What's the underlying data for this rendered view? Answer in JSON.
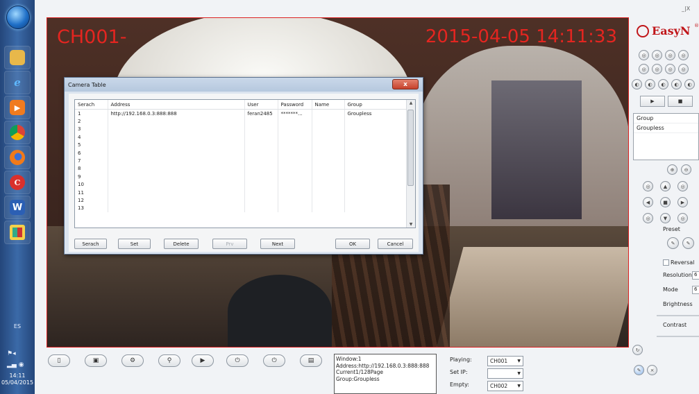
{
  "taskbar": {
    "language": "ES",
    "time": "14:11",
    "date": "05/04/2015"
  },
  "video": {
    "channel_label": "CH001-",
    "datetime": "2015-04-05 14:11:33"
  },
  "dialog": {
    "title": "Camera Table",
    "close_glyph": "x",
    "columns": [
      "Serach",
      "Address",
      "User",
      "Password",
      "Name",
      "Group"
    ],
    "rows": [
      [
        "1",
        "http://192.168.0.3:888:888",
        "feran2485",
        "*******...",
        "",
        "Groupless"
      ],
      [
        "2",
        "",
        "",
        "",
        "",
        ""
      ],
      [
        "3",
        "",
        "",
        "",
        "",
        ""
      ],
      [
        "4",
        "",
        "",
        "",
        "",
        ""
      ],
      [
        "5",
        "",
        "",
        "",
        "",
        ""
      ],
      [
        "6",
        "",
        "",
        "",
        "",
        ""
      ],
      [
        "7",
        "",
        "",
        "",
        "",
        ""
      ],
      [
        "8",
        "",
        "",
        "",
        "",
        ""
      ],
      [
        "9",
        "",
        "",
        "",
        "",
        ""
      ],
      [
        "10",
        "",
        "",
        "",
        "",
        ""
      ],
      [
        "11",
        "",
        "",
        "",
        "",
        ""
      ],
      [
        "12",
        "",
        "",
        "",
        "",
        ""
      ],
      [
        "13",
        "",
        "",
        "",
        "",
        ""
      ]
    ],
    "buttons": {
      "serach": "Serach",
      "set": "Set",
      "delete": "Delete",
      "prv": "Prv",
      "next": "Next",
      "ok": "OK",
      "cancel": "Cancel"
    }
  },
  "panel": {
    "brand": "EasyN",
    "brand_mark": "®",
    "window_controls": "_|X",
    "play_glyph": "▶",
    "stop_glyph": "■",
    "group_list": [
      "Group",
      "Groupless"
    ],
    "preset_label": "Preset",
    "reversal_label": "Reversal",
    "resolution_label": "Resolution",
    "resolution_value": "6",
    "mode_label": "Mode",
    "mode_value": "6",
    "brightness_label": "Brightness",
    "contrast_label": "Contrast"
  },
  "status": {
    "info_lines": [
      "Window:1",
      "Address:http://192.168.0.3:888:888",
      "Current1/128Page",
      "Group:Groupless"
    ],
    "playing_label": "Playing:",
    "playing_value": "CH001",
    "setip_label": "Set IP:",
    "setip_value": "",
    "empty_label": "Empty:",
    "empty_value": "CH002"
  },
  "colors": {
    "osd_red": "#ff2420",
    "video_border": "#dd2222",
    "taskbar_blue": "#2f5a94",
    "dialog_title": "#c9d8ea"
  }
}
